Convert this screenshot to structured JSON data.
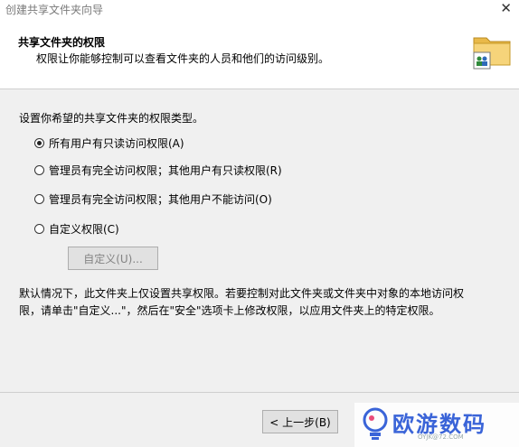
{
  "window": {
    "title": "创建共享文件夹向导",
    "close_glyph": "✕"
  },
  "header": {
    "title": "共享文件夹的权限",
    "subtitle": "权限让你能够控制可以查看文件夹的人员和他们的访问级别。"
  },
  "main": {
    "prompt": "设置你希望的共享文件夹的权限类型。",
    "options": [
      {
        "label": "所有用户有只读访问权限(A)",
        "selected": true
      },
      {
        "label": "管理员有完全访问权限；其他用户有只读权限(R)",
        "selected": false
      },
      {
        "label": "管理员有完全访问权限；其他用户不能访问(O)",
        "selected": false
      },
      {
        "label": "自定义权限(C)",
        "selected": false
      }
    ],
    "custom_button": "自定义(U)...",
    "note_line1": "默认情况下，此文件夹上仅设置共享权限。若要控制对此文件夹或文件夹中对象的本地访问权",
    "note_line2": "限，请单击\"自定义...\"，然后在\"安全\"选项卡上修改权限，以应用文件夹上的特定权限。"
  },
  "footer": {
    "back_button": "< 上一步(B)"
  },
  "watermark": {
    "text": "欧游数码",
    "url": "OYJK@72.COM"
  },
  "icons": {
    "folder": "shared-folder-icon",
    "logo": "bulb-logo"
  }
}
